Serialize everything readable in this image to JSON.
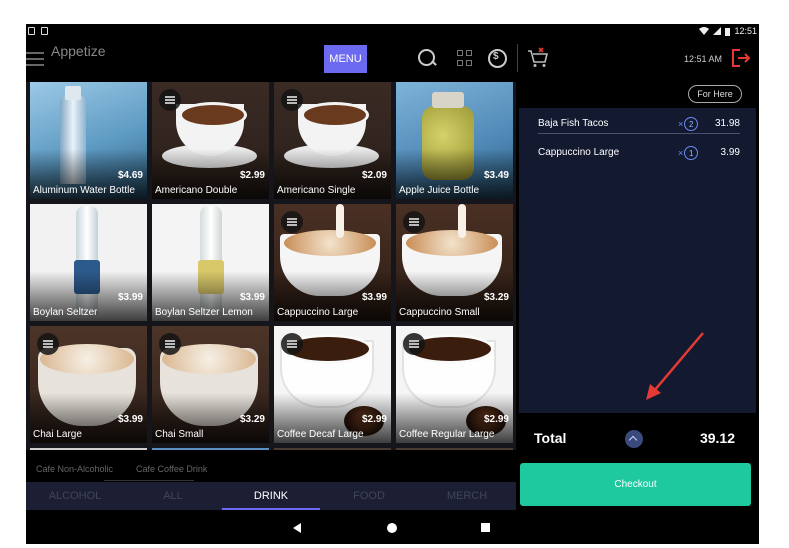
{
  "status_bar": {
    "time": "12:51"
  },
  "header": {
    "app_title": "Appetize",
    "menu_label": "MENU",
    "time": "12:51 AM"
  },
  "products": [
    {
      "name": "Aluminum Water Bottle",
      "price": "$4.69"
    },
    {
      "name": "Americano Double",
      "price": "$2.99"
    },
    {
      "name": "Americano Single",
      "price": "$2.09"
    },
    {
      "name": "Apple Juice Bottle",
      "price": "$3.49"
    },
    {
      "name": "Boylan Seltzer",
      "price": "$3.99"
    },
    {
      "name": "Boylan Seltzer Lemon",
      "price": "$3.99"
    },
    {
      "name": "Cappuccino Large",
      "price": "$3.99"
    },
    {
      "name": "Cappuccino Small",
      "price": "$3.29"
    },
    {
      "name": "Chai Large",
      "price": "$3.99"
    },
    {
      "name": "Chai Small",
      "price": "$3.29"
    },
    {
      "name": "Coffee Decaf Large",
      "price": "$2.99"
    },
    {
      "name": "Coffee Regular Large",
      "price": "$2.99"
    }
  ],
  "subcategories": [
    "Cafe Non-Alcoholic",
    "Cafe Coffee Drink"
  ],
  "tabs": [
    "ALCOHOL",
    "ALL",
    "DRINK",
    "FOOD",
    "MERCH"
  ],
  "active_tab": "DRINK",
  "order": {
    "mode": "For Here",
    "items": [
      {
        "name": "Baja Fish Tacos",
        "qty_prefix": "×",
        "qty": "2",
        "price": "31.98"
      },
      {
        "name": "Cappuccino Large",
        "qty_prefix": "×",
        "qty": "1",
        "price": "3.99"
      }
    ],
    "total_label": "Total",
    "total_value": "39.12",
    "checkout_label": "Checkout"
  },
  "colors": {
    "accent": "#6c6af0",
    "checkout": "#1ec9a0",
    "order_bg": "#131a30",
    "annotation": "#e53935"
  }
}
